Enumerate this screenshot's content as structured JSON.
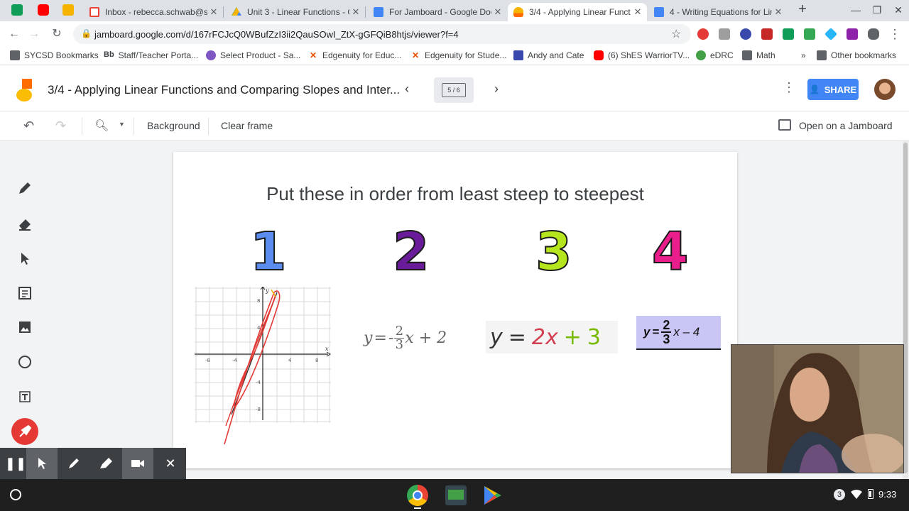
{
  "browser": {
    "tabs": [
      {
        "title": "Inbox - rebecca.schwab@sy",
        "favicon": "gmail-icon"
      },
      {
        "title": "Unit 3 - Linear Functions - G",
        "favicon": "drive-icon"
      },
      {
        "title": "For Jamboard - Google Doc",
        "favicon": "docs-icon"
      },
      {
        "title": "3/4 - Applying Linear Funct",
        "favicon": "jamboard-icon",
        "active": true
      },
      {
        "title": "4 - Writing Equations for Lin",
        "favicon": "docs-icon"
      }
    ],
    "new_tab": "+",
    "url": "jamboard.google.com/d/167rFCJcQ0WBufZzI3ii2QauSOwI_ZtX-gGFQiB8htjs/viewer?f=4",
    "bookmarks": [
      {
        "label": "SYCSD Bookmarks",
        "icon": "folder-icon"
      },
      {
        "label": "Staff/Teacher Porta...",
        "icon": "blackboard-icon"
      },
      {
        "label": "Select Product - Sa...",
        "icon": "savvas-icon"
      },
      {
        "label": "Edgenuity for Educ...",
        "icon": "edgenuity-icon"
      },
      {
        "label": "Edgenuity for Stude...",
        "icon": "edgenuity-icon"
      },
      {
        "label": "Andy and Cate",
        "icon": "calendar-icon"
      },
      {
        "label": "(6) ShES WarriorTV...",
        "icon": "youtube-icon"
      },
      {
        "label": "eDRC",
        "icon": "edrc-icon"
      },
      {
        "label": "Math",
        "icon": "folder-icon"
      }
    ],
    "bookmarks_more": "»",
    "other_bookmarks": "Other bookmarks"
  },
  "jamboard": {
    "title": "3/4 - Applying Linear Functions and Comparing Slopes and Inter...",
    "frame_indicator": "5 / 6",
    "share_label": "SHARE",
    "toolbar": {
      "background_label": "Background",
      "clear_frame_label": "Clear frame",
      "open_on_jamboard_label": "Open on a Jamboard"
    },
    "frame": {
      "title": "Put these in order from least steep to steepest",
      "numbers": [
        "1",
        "2",
        "3",
        "4"
      ],
      "graph_ticks": {
        "x": [
          "-8",
          "-4",
          "4",
          "8"
        ],
        "y": [
          "8",
          "4",
          "-4",
          "-8"
        ],
        "x_axis": "x",
        "y_axis": "y"
      },
      "eq2": {
        "y": "y",
        "eq": "=",
        "neg": "-",
        "num": "2",
        "den": "3",
        "rest": "x + 2"
      },
      "eq3": {
        "y": "y",
        "eq": "=",
        "coef": "2x",
        "plus": "+",
        "const": "3"
      },
      "eq4": {
        "y": "y",
        "eq": "=",
        "num": "2",
        "den": "3",
        "rest": "x – 4"
      }
    }
  },
  "taskbar": {
    "clock": "9:33",
    "notification_count": "3"
  },
  "colors": {
    "num1": "#5b8def",
    "num2": "#6a1b9a",
    "num3": "#b5e61d",
    "num4": "#e91e8c",
    "eq4_bg": "#c9c6f5",
    "share": "#4285f4"
  }
}
